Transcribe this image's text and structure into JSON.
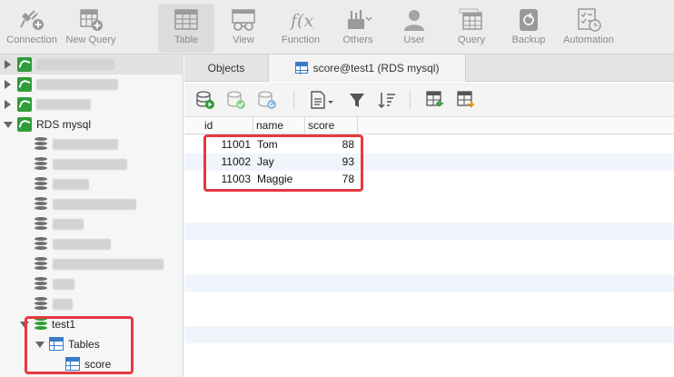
{
  "toolbar": {
    "items": [
      {
        "label": "Connection",
        "icon": "plug-plus-icon"
      },
      {
        "label": "New Query",
        "icon": "grid-plus-icon"
      },
      {
        "label": "Table",
        "icon": "table-icon",
        "active": true
      },
      {
        "label": "View",
        "icon": "glasses-table-icon"
      },
      {
        "label": "Function",
        "icon": "function-fx-icon"
      },
      {
        "label": "Others",
        "icon": "tools-icon"
      },
      {
        "label": "User",
        "icon": "user-icon"
      },
      {
        "label": "Query",
        "icon": "query-table-icon"
      },
      {
        "label": "Backup",
        "icon": "backup-icon"
      },
      {
        "label": "Automation",
        "icon": "checklist-clock-icon"
      }
    ]
  },
  "sidebar": {
    "connection_name": "RDS mysql",
    "database_name": "test1",
    "tables_label": "Tables",
    "table_name": "score"
  },
  "tabs": {
    "objects": "Objects",
    "active_tab": "score@test1 (RDS mysql)"
  },
  "grid": {
    "columns": [
      "id",
      "name",
      "score"
    ],
    "rows": [
      {
        "id": "11001",
        "name": "Tom",
        "score": "88"
      },
      {
        "id": "11002",
        "name": "Jay",
        "score": "93"
      },
      {
        "id": "11003",
        "name": "Maggie",
        "score": "78"
      }
    ]
  },
  "colors": {
    "highlight": "#e5383f",
    "mysql_green": "#2f9e3a",
    "table_blue": "#3a7bc8",
    "row_alt": "#eff5fb"
  }
}
